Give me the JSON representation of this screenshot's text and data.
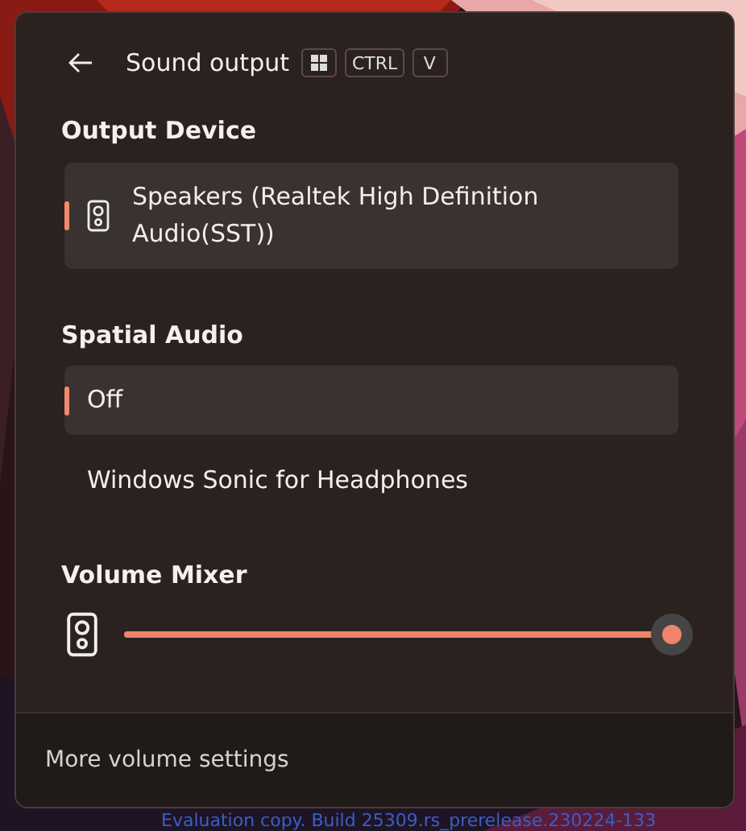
{
  "header": {
    "title": "Sound output",
    "shortcut_keys": [
      {
        "kind": "windows-logo"
      },
      {
        "kind": "text",
        "label": "CTRL"
      },
      {
        "kind": "text",
        "label": "V"
      }
    ]
  },
  "output_device": {
    "heading": "Output Device",
    "items": [
      {
        "label": "Speakers (Realtek High Definition Audio(SST))",
        "selected": true
      }
    ]
  },
  "spatial_audio": {
    "heading": "Spatial Audio",
    "items": [
      {
        "label": "Off",
        "selected": true
      },
      {
        "label": "Windows Sonic for Headphones",
        "selected": false
      }
    ]
  },
  "volume_mixer": {
    "heading": "Volume Mixer",
    "level": 1.0
  },
  "footer": {
    "link": "More volume settings"
  },
  "desktop": {
    "watermark_text": "Evaluation copy. Build 25309.rs_prerelease.230224-133"
  }
}
